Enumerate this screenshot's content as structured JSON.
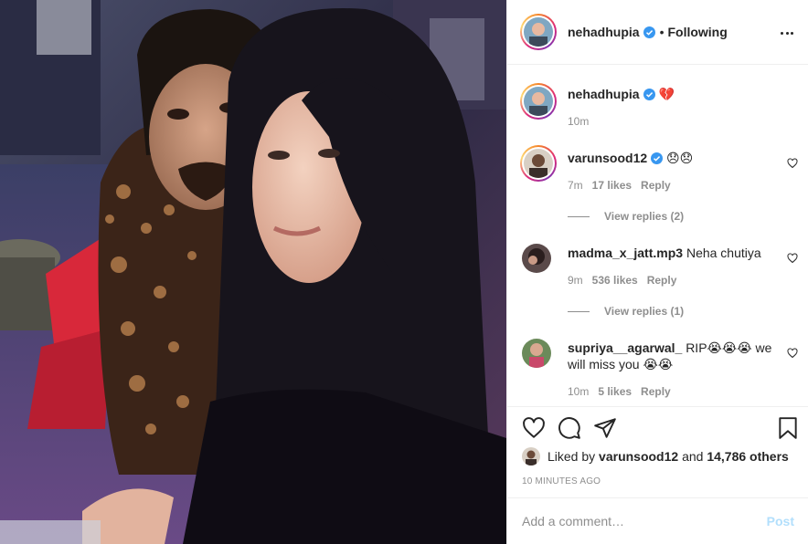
{
  "post": {
    "author": "nehadhupia",
    "header_dot": "•",
    "follow_label": "Following",
    "caption": "💔",
    "caption_time": "10m"
  },
  "comments": [
    {
      "user": "varunsood12",
      "verified": true,
      "text": "😞😞",
      "time": "7m",
      "likes": "17 likes",
      "reply": "Reply",
      "view_replies": "View replies (2)"
    },
    {
      "user": "madma_x_jatt.mp3",
      "verified": false,
      "text": "Neha chutiya",
      "time": "9m",
      "likes": "536 likes",
      "reply": "Reply",
      "view_replies": "View replies (1)"
    },
    {
      "user": "supriya__agarwal_",
      "verified": false,
      "text": "RIP😭😭😭 we will miss you 😭😭",
      "time": "10m",
      "likes": "5 likes",
      "reply": "Reply"
    }
  ],
  "likes": {
    "prefix": "Liked by",
    "user": "varunsood12",
    "and": "and",
    "others": "14,786 others"
  },
  "timestamp": "10 MINUTES AGO",
  "add_comment": {
    "placeholder": "Add a comment…",
    "post_label": "Post"
  },
  "icons": {
    "verified": "verified-badge-icon",
    "more": "more-options-icon",
    "like": "heart-icon",
    "comment": "comment-bubble-icon",
    "share": "paper-plane-icon",
    "save": "bookmark-icon"
  },
  "colors": {
    "verified": "#3897f0",
    "text": "#262626",
    "muted": "#8e8e8e",
    "post_disabled": "#b2dffc"
  }
}
